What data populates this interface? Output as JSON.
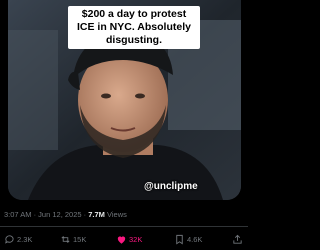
{
  "post": {
    "video_caption": "$200 a day to protest ICE in NYC. Absolutely disgusting.",
    "watermark": "@unclipme",
    "timestamp": "3:07 AM · Jun 12, 2025 · ",
    "views_count": "7.7M",
    "views_label": " Views"
  },
  "actions": {
    "replies": "2.3K",
    "reposts": "15K",
    "likes": "32K",
    "bookmarks": "4.6K"
  },
  "colors": {
    "background": "#000000",
    "muted_text": "#71767b",
    "like_pink": "#f91880"
  },
  "icons": [
    "reply-icon",
    "repost-icon",
    "heart-icon",
    "bookmark-icon",
    "share-icon"
  ]
}
